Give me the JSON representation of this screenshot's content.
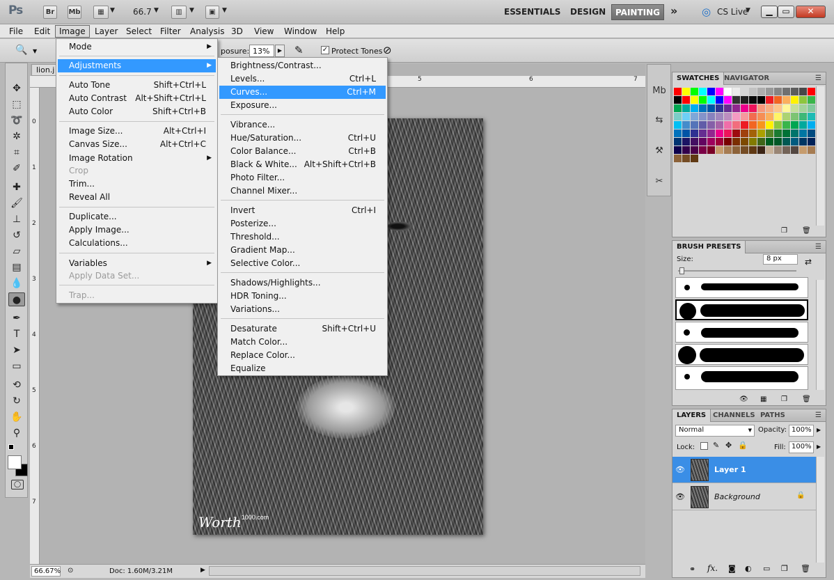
{
  "titlebar": {
    "logo": "Ps",
    "bridge_label": "Br",
    "minibridge_label": "Mb",
    "zoom_value": "66.7",
    "workspaces": [
      "ESSENTIALS",
      "DESIGN"
    ],
    "active_workspace": "PAINTING",
    "more": "»",
    "cs_live": "CS Live"
  },
  "menubar": [
    "File",
    "Edit",
    "Image",
    "Layer",
    "Select",
    "Filter",
    "Analysis",
    "3D",
    "View",
    "Window",
    "Help"
  ],
  "options": {
    "exposure_label": "posure:",
    "exposure_value": "13%",
    "protect_tones_label": "Protect Tones"
  },
  "document": {
    "tab_title": "lion.j",
    "watermark_main": "Worth",
    "watermark_small": "1000.com",
    "ruler_left": [
      "0",
      "1",
      "2",
      "3",
      "4",
      "5",
      "6",
      "7"
    ],
    "ruler_top": [
      "5",
      "6",
      "7"
    ]
  },
  "status": {
    "zoom": "66.67%",
    "doc": "Doc: 1.60M/3.21M"
  },
  "image_menu": {
    "items": [
      {
        "label": "Mode",
        "shortcut": "",
        "submenu": true
      },
      {
        "label": "Adjustments",
        "shortcut": "",
        "submenu": true,
        "highlighted": true
      },
      {
        "label": "Auto Tone",
        "shortcut": "Shift+Ctrl+L"
      },
      {
        "label": "Auto Contrast",
        "shortcut": "Alt+Shift+Ctrl+L"
      },
      {
        "label": "Auto Color",
        "shortcut": "Shift+Ctrl+B"
      },
      {
        "label": "Image Size...",
        "shortcut": "Alt+Ctrl+I"
      },
      {
        "label": "Canvas Size...",
        "shortcut": "Alt+Ctrl+C"
      },
      {
        "label": "Image Rotation",
        "shortcut": "",
        "submenu": true
      },
      {
        "label": "Crop",
        "shortcut": "",
        "disabled": true
      },
      {
        "label": "Trim...",
        "shortcut": ""
      },
      {
        "label": "Reveal All",
        "shortcut": ""
      },
      {
        "label": "Duplicate...",
        "shortcut": ""
      },
      {
        "label": "Apply Image...",
        "shortcut": ""
      },
      {
        "label": "Calculations...",
        "shortcut": ""
      },
      {
        "label": "Variables",
        "shortcut": "",
        "submenu": true
      },
      {
        "label": "Apply Data Set...",
        "shortcut": "",
        "disabled": true
      },
      {
        "label": "Trap...",
        "shortcut": "",
        "disabled": true
      }
    ]
  },
  "adjustments_menu": {
    "items": [
      {
        "label": "Brightness/Contrast...",
        "shortcut": ""
      },
      {
        "label": "Levels...",
        "shortcut": "Ctrl+L"
      },
      {
        "label": "Curves...",
        "shortcut": "Ctrl+M",
        "highlighted": true
      },
      {
        "label": "Exposure...",
        "shortcut": ""
      },
      {
        "label": "Vibrance...",
        "shortcut": ""
      },
      {
        "label": "Hue/Saturation...",
        "shortcut": "Ctrl+U"
      },
      {
        "label": "Color Balance...",
        "shortcut": "Ctrl+B"
      },
      {
        "label": "Black & White...",
        "shortcut": "Alt+Shift+Ctrl+B"
      },
      {
        "label": "Photo Filter...",
        "shortcut": ""
      },
      {
        "label": "Channel Mixer...",
        "shortcut": ""
      },
      {
        "label": "Invert",
        "shortcut": "Ctrl+I"
      },
      {
        "label": "Posterize...",
        "shortcut": ""
      },
      {
        "label": "Threshold...",
        "shortcut": ""
      },
      {
        "label": "Gradient Map...",
        "shortcut": ""
      },
      {
        "label": "Selective Color...",
        "shortcut": ""
      },
      {
        "label": "Shadows/Highlights...",
        "shortcut": ""
      },
      {
        "label": "HDR Toning...",
        "shortcut": ""
      },
      {
        "label": "Variations...",
        "shortcut": ""
      },
      {
        "label": "Desaturate",
        "shortcut": "Shift+Ctrl+U"
      },
      {
        "label": "Match Color...",
        "shortcut": ""
      },
      {
        "label": "Replace Color...",
        "shortcut": ""
      },
      {
        "label": "Equalize",
        "shortcut": ""
      }
    ]
  },
  "swatches_panel": {
    "tabs": [
      "SWATCHES",
      "NAVIGATOR"
    ],
    "colors": [
      "#ff0000",
      "#ffff00",
      "#00ff00",
      "#00ffff",
      "#0000ff",
      "#ff00ff",
      "#ffffff",
      "#ebebeb",
      "#d6d6d6",
      "#c2c2c2",
      "#adadad",
      "#999999",
      "#858585",
      "#707070",
      "#5c5c5c",
      "#474747",
      "#ff0000",
      "#000000",
      "#ff0000",
      "#ffff00",
      "#00ff00",
      "#00ffff",
      "#0000ff",
      "#ff00ff",
      "#333333",
      "#1f1f1f",
      "#0a0a0a",
      "#000000",
      "#ee1d24",
      "#f26522",
      "#fbaf5d",
      "#fff200",
      "#8dc63f",
      "#39b54a",
      "#00a651",
      "#00a99d",
      "#00aeef",
      "#0072bc",
      "#0054a6",
      "#2e3192",
      "#662d91",
      "#92278f",
      "#ec008c",
      "#ed145b",
      "#f7977a",
      "#f9ad81",
      "#fdc68a",
      "#fff79a",
      "#c4df9b",
      "#a3d39c",
      "#82ca9d",
      "#7bcdc8",
      "#6ecff6",
      "#7ea7d8",
      "#8493ca",
      "#8882be",
      "#a187be",
      "#bc8dbf",
      "#f49ac2",
      "#f6989d",
      "#f26c4f",
      "#f68e55",
      "#fbaf5c",
      "#fff467",
      "#acd372",
      "#7dc473",
      "#3cb878",
      "#1cbbb4",
      "#00bff3",
      "#448ccb",
      "#5574b9",
      "#605ca8",
      "#855fa8",
      "#a763a8",
      "#f06ea9",
      "#f26d7d",
      "#ed1c24",
      "#f26522",
      "#f7941d",
      "#fff200",
      "#8dc73f",
      "#39b54a",
      "#00a651",
      "#00a99d",
      "#00aeef",
      "#0072bc",
      "#0054a6",
      "#2e3192",
      "#662d91",
      "#92278f",
      "#ec008c",
      "#ed145b",
      "#9e0b0f",
      "#a0410d",
      "#a36209",
      "#aba000",
      "#598527",
      "#1a7b30",
      "#007236",
      "#00746b",
      "#0076a3",
      "#004b80",
      "#003471",
      "#1b1464",
      "#440e62",
      "#630460",
      "#9e005d",
      "#9e0039",
      "#790000",
      "#7b2e00",
      "#7d4900",
      "#827b00",
      "#406618",
      "#005e20",
      "#005826",
      "#005952",
      "#005b7f",
      "#003663",
      "#002157",
      "#0d004c",
      "#32004b",
      "#4b0049",
      "#7b0046",
      "#7a0026",
      "#c69c6d",
      "#a67c52",
      "#8c6239",
      "#754c24",
      "#603913",
      "#3c2415",
      "#c7b299",
      "#998675",
      "#736357",
      "#534741",
      "#c69c6d",
      "#a67c52",
      "#8c6239",
      "#754c24",
      "#603913"
    ]
  },
  "brush_panel": {
    "tab": "BRUSH PRESETS",
    "size_label": "Size:",
    "size_value": "8 px"
  },
  "layers_panel": {
    "tabs": [
      "LAYERS",
      "CHANNELS",
      "PATHS"
    ],
    "blend_mode": "Normal",
    "opacity_label": "Opacity:",
    "opacity_value": "100%",
    "lock_label": "Lock:",
    "fill_label": "Fill:",
    "fill_value": "100%",
    "layers": [
      "Layer 1",
      "Background"
    ]
  }
}
